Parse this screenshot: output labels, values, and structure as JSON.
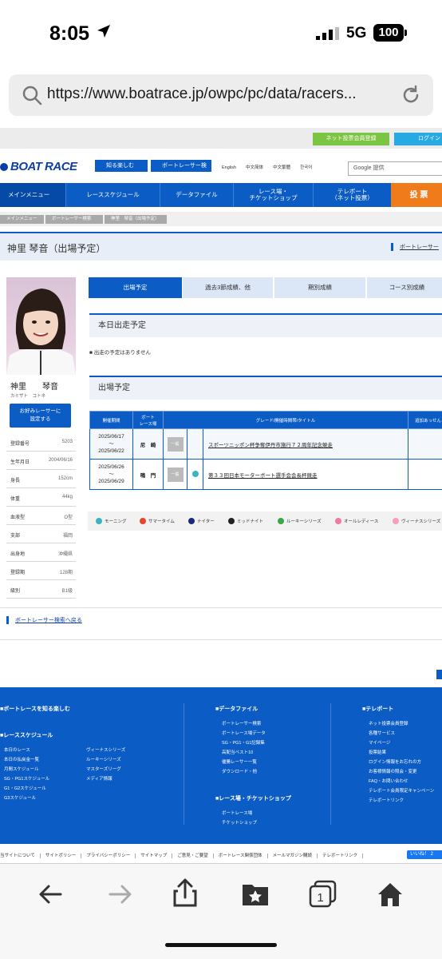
{
  "status": {
    "time": "8:05",
    "network": "5G",
    "battery": "100"
  },
  "browser": {
    "url": "https://www.boatrace.jp/owpc/pc/data/racers..."
  },
  "header": {
    "net_vote_register": "ネット投票会員登録",
    "login": "ログイン",
    "logo": "BOAT RACE",
    "btn_fun": "知る楽しむ",
    "btn_racer_search": "ボートレーサー検索",
    "langs": [
      "English",
      "中文简体",
      "中文繁體",
      "한국어"
    ],
    "google": "Google 提供"
  },
  "nav": {
    "main": "メインメニュー",
    "items": [
      "レーススケジュール",
      "データファイル",
      "レース場・\nチケットショップ",
      "テレボート\n（ネット投票）"
    ],
    "vote": "投 票"
  },
  "breadcrumb": [
    "メインメニュー",
    "ボートレーサー検索",
    "神里　琴音（出場予定）"
  ],
  "page_title": "神里 琴音（出場予定）",
  "back_to_search_top": "ボートレーサー",
  "profile": {
    "name": "神里　　琴音",
    "kana": "カミザト　コトネ",
    "fav_button": "お好みレーサーに\n設定する",
    "rows": [
      {
        "k": "登録番号",
        "v": "5203"
      },
      {
        "k": "生年月日",
        "v": "2004/06/16"
      },
      {
        "k": "身長",
        "v": "152cm"
      },
      {
        "k": "体重",
        "v": "44kg"
      },
      {
        "k": "血液型",
        "v": "O型"
      },
      {
        "k": "支部",
        "v": "福岡"
      },
      {
        "k": "出身地",
        "v": "沖縄県"
      },
      {
        "k": "登録期",
        "v": "128期"
      },
      {
        "k": "級別",
        "v": "B1級"
      }
    ]
  },
  "tabs": [
    "出場予定",
    "過去3節成績、他",
    "期別成績",
    "コース別成績"
  ],
  "today": {
    "heading": "本日出走予定",
    "note": "出走の予定はありません"
  },
  "schedule": {
    "heading": "出場予定",
    "columns": [
      "開催期間",
      "ボート\nレース場",
      "グレード/開催時間帯/タイトル",
      "追加あっせん"
    ],
    "rows": [
      {
        "period": "2025/06/17\n〜\n2025/06/22",
        "venue": "尼　崎",
        "grade": "一般",
        "time_icon": "",
        "title": "スポーツニッポン杯争奪伊丹市施行７２周年記念競走"
      },
      {
        "period": "2025/06/26\n〜\n2025/06/29",
        "venue": "鳴　門",
        "grade": "一般",
        "time_icon": "morning",
        "title": "第３３回日本モーターボート選手会会長杯競走"
      }
    ]
  },
  "legend": [
    {
      "label": "モーニング",
      "color": "#3bb3c3"
    },
    {
      "label": "サマータイム",
      "color": "#e8452c"
    },
    {
      "label": "ナイター",
      "color": "#1a2a7a"
    },
    {
      "label": "ミッドナイト",
      "color": "#222222"
    },
    {
      "label": "ルーキーシリーズ",
      "color": "#3aa845"
    },
    {
      "label": "オールレディース",
      "color": "#f27aa0"
    },
    {
      "label": "ヴィーナスシリーズ",
      "color": "#f5a0b8"
    }
  ],
  "back_to_search": "ボートレーサー検索へ戻る",
  "footer": {
    "h_know": "■ボートレースを知る楽しむ",
    "h_schedule": "■レーススケジュール",
    "sched_col1": "本日のレース\n本日の払戻金一覧\n月間スケジュール\nSG・PG1スケジュール\nG1・G2スケジュール\nG3スケジュール",
    "sched_col2": "ヴィーナスシリーズ\nルーキーシリーズ\nマスターズリーグ\nメディア情報",
    "h_data": "■データファイル",
    "data_links": "ボートレーサー検索\nボートレース場データ\nSG・PG1・G1記録集\n高配当ベスト10\n優勝レーサー一覧\nダウンロード・他",
    "h_shop": "■レース場・チケットショップ",
    "shop_links": "ボートレース場\nチケットショップ",
    "h_tele": "■テレボート",
    "tele_links": "ネット投票会員登録\n各種サービス\nマイページ\n投票結果\nログイン情報をお忘れの方\nお客様情報の照会・変更\nFAQ・お問い合わせ\nテレボート会員限定キャンペーン\nテレボートリンク"
  },
  "bottom_links": [
    "当サイトについて",
    "サイトポリシー",
    "プライバシーポリシー",
    "サイトマップ",
    "ご意見・ご要望",
    "ボートレース関係団体",
    "メールマガジン購読",
    "テレボートリンク"
  ],
  "like": "いいね！ 2"
}
